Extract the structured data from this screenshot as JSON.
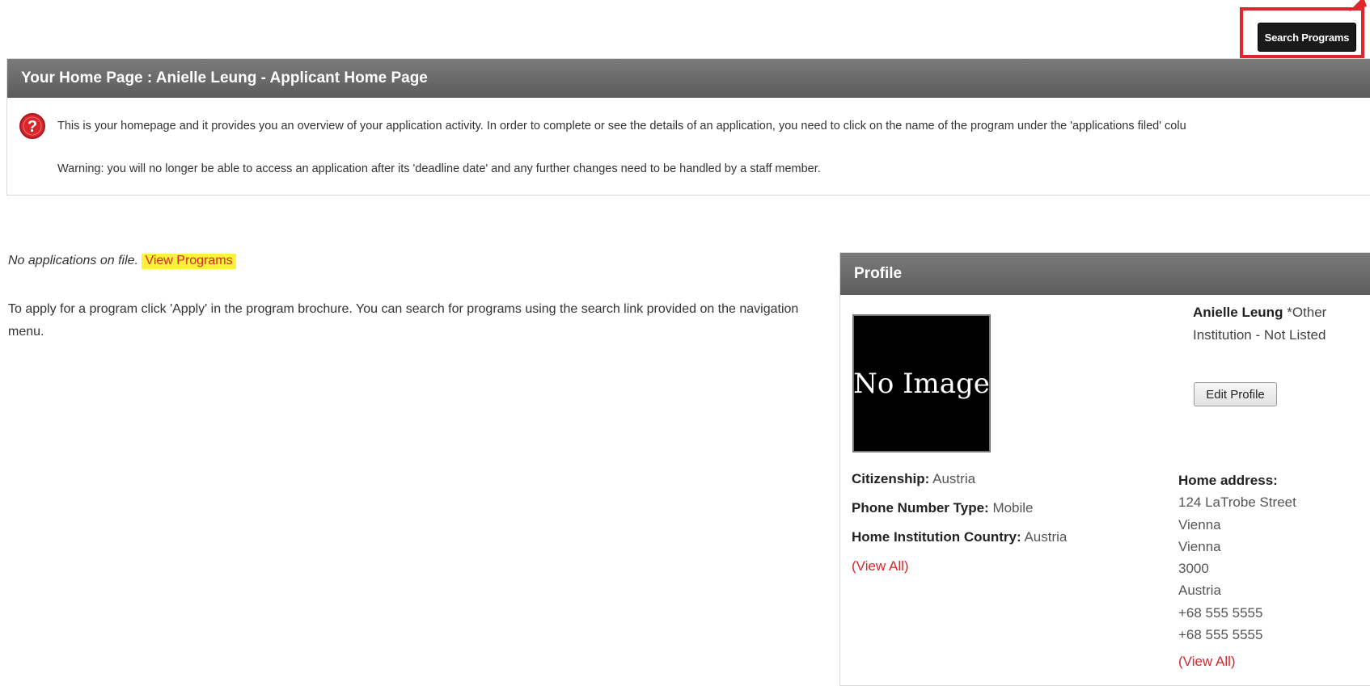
{
  "toolbar": {
    "search_programs_label": "Search Programs"
  },
  "home": {
    "title": "Your Home Page : Anielle Leung - Applicant Home Page",
    "intro": "This is your homepage and it provides you an overview of your application activity. In order to complete or see the details of an application, you need to click on the name of the program under the 'applications filed' colu",
    "warning": "Warning: you will no longer be able to access an application after its 'deadline date' and any further changes need to be handled by a staff member."
  },
  "applications": {
    "none_text": "No applications on file.",
    "view_programs_link": "View Programs",
    "apply_text": "To apply for a program click 'Apply' in the program brochure. You can search for programs using the search link provided on the navigation menu."
  },
  "profile": {
    "header": "Profile",
    "photo_placeholder": "No Image",
    "name": "Anielle Leung",
    "institution": "*Other Institution - Not Listed",
    "edit_label": "Edit Profile",
    "citizenship_label": "Citizenship:",
    "citizenship_value": "Austria",
    "phone_type_label": "Phone Number Type:",
    "phone_type_value": "Mobile",
    "home_country_label": "Home Institution Country:",
    "home_country_value": "Austria",
    "view_all_label": "(View All)",
    "address_label": "Home address:",
    "address_lines": [
      "124 LaTrobe Street",
      "Vienna",
      "Vienna",
      "3000",
      "Austria",
      "+68 555 5555",
      "+68 555 5555"
    ],
    "address_view_all_label": "(View All)"
  },
  "colors": {
    "header_bg": "#666666",
    "highlight_red": "#e0262b",
    "link_red": "#d6262b",
    "link_highlight": "#fdf23a"
  },
  "icons": {
    "help": "question-circle-icon",
    "arrow": "arrow-annotation-icon"
  }
}
